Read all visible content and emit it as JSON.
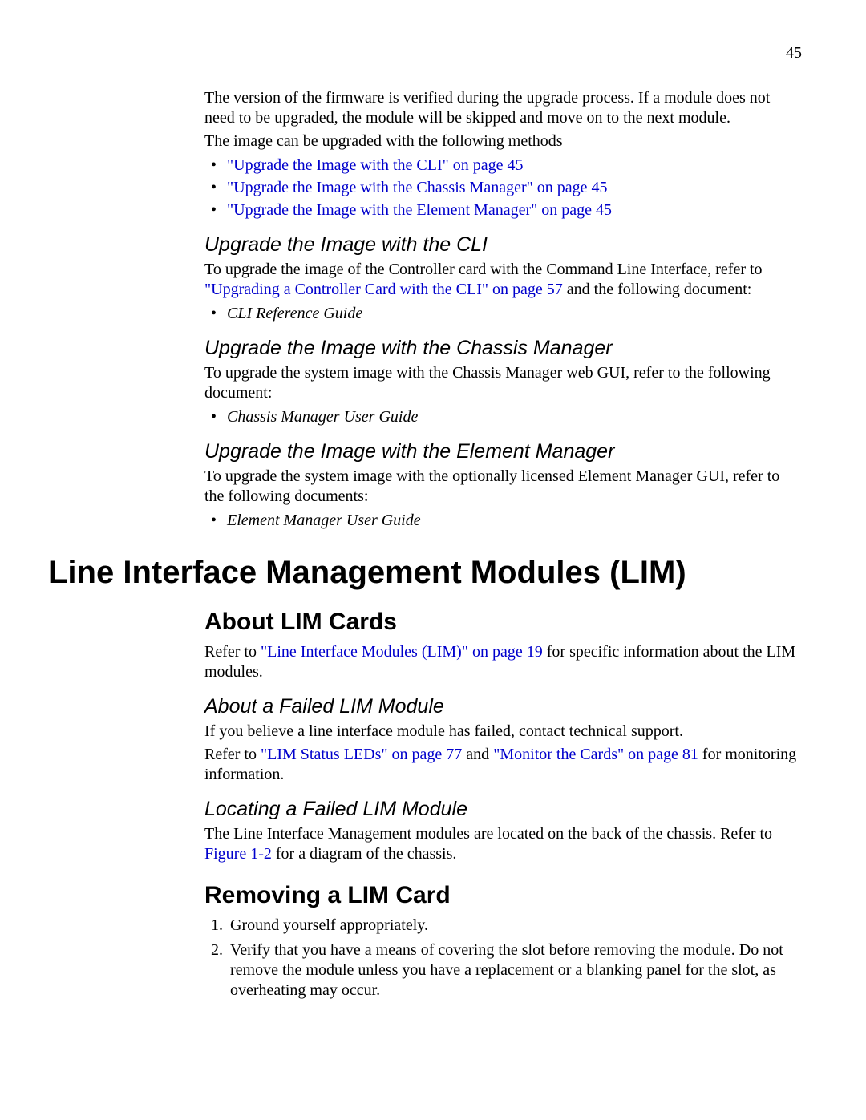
{
  "page_number": "45",
  "intro": {
    "p1": "The version of the firmware is verified during the upgrade process. If a module does not need to be upgraded, the module will be skipped and move on to the next module.",
    "p2": "The image can be upgraded with the following methods",
    "links": [
      "\"Upgrade the Image with the CLI\" on page 45",
      "\"Upgrade the Image with the Chassis Manager\" on page 45",
      "\"Upgrade the Image with the Element Manager\" on page 45"
    ]
  },
  "cli": {
    "heading": "Upgrade the Image with the CLI",
    "p_pre": "To upgrade the image of the Controller card with the Command Line Interface, refer to ",
    "link": "\"Upgrading a Controller Card with the CLI\" on page 57",
    "p_post": " and the following document:",
    "doc": "CLI Reference Guide"
  },
  "chassis": {
    "heading": "Upgrade the Image with the Chassis Manager",
    "p": "To upgrade the system image with the Chassis Manager web GUI, refer to the following document:",
    "doc": "Chassis Manager User Guide"
  },
  "element": {
    "heading": "Upgrade the Image with the Element Manager",
    "p": "To upgrade the system image with the optionally licensed Element Manager GUI, refer to the following documents:",
    "doc": "Element Manager User Guide"
  },
  "lim": {
    "chapter": "Line Interface Management Modules (LIM)",
    "about": {
      "heading": "About LIM Cards",
      "p_pre": "Refer to ",
      "link": "\"Line Interface Modules (LIM)\" on page 19",
      "p_post": " for specific information about the LIM modules."
    },
    "failed": {
      "heading": "About a Failed LIM Module",
      "p1": "If you believe a line interface module has failed, contact technical support.",
      "p2_pre": "Refer to ",
      "link1": "\"LIM Status LEDs\" on page 77",
      "mid": " and ",
      "link2": "\"Monitor the Cards\" on page 81",
      "p2_post": " for monitoring information."
    },
    "locating": {
      "heading": "Locating a Failed LIM Module",
      "p_pre": "The Line Interface Management modules are located on the back of the chassis. Refer to ",
      "link": "Figure 1-2",
      "p_post": " for a diagram of the chassis."
    },
    "removing": {
      "heading": "Removing a LIM Card",
      "steps": [
        "Ground yourself appropriately.",
        "Verify that you have a means of covering the slot before removing the module. Do not remove the module unless you have a replacement or a blanking panel for the slot, as overheating may occur."
      ]
    }
  }
}
